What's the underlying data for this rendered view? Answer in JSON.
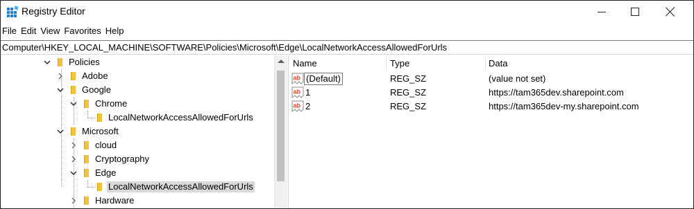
{
  "window": {
    "title": "Registry Editor"
  },
  "menu": [
    "File",
    "Edit",
    "View",
    "Favorites",
    "Help"
  ],
  "address": "Computer\\HKEY_LOCAL_MACHINE\\SOFTWARE\\Policies\\Microsoft\\Edge\\LocalNetworkAccessAllowedForUrls",
  "tree": [
    {
      "label": "Policies",
      "state": "expanded"
    },
    {
      "label": "Adobe",
      "state": "collapsed"
    },
    {
      "label": "Google",
      "state": "expanded"
    },
    {
      "label": "Chrome",
      "state": "expanded"
    },
    {
      "label": "LocalNetworkAccessAllowedForUrls",
      "state": "leaf"
    },
    {
      "label": "Microsoft",
      "state": "expanded"
    },
    {
      "label": "cloud",
      "state": "collapsed"
    },
    {
      "label": "Cryptography",
      "state": "collapsed"
    },
    {
      "label": "Edge",
      "state": "expanded"
    },
    {
      "label": "LocalNetworkAccessAllowedForUrls",
      "state": "leaf",
      "selected": true
    },
    {
      "label": "Hardware",
      "state": "collapsed"
    }
  ],
  "columns": {
    "name": "Name",
    "type": "Type",
    "data": "Data"
  },
  "values": [
    {
      "name": "(Default)",
      "type": "REG_SZ",
      "data": "(value not set)"
    },
    {
      "name": "1",
      "type": "REG_SZ",
      "data": "https://tam365dev.sharepoint.com"
    },
    {
      "name": "2",
      "type": "REG_SZ",
      "data": "https://tam365dev-my.sharepoint.com"
    }
  ],
  "colors": {
    "folder": "#e8b923",
    "folder_dark": "#d49e0e",
    "selected_bg": "#d9d9d9",
    "value_icon": "#d9452a"
  },
  "icons": {
    "app": "registry-editor-icon",
    "string_value": "reg-sz-icon",
    "folder": "folder-icon"
  }
}
